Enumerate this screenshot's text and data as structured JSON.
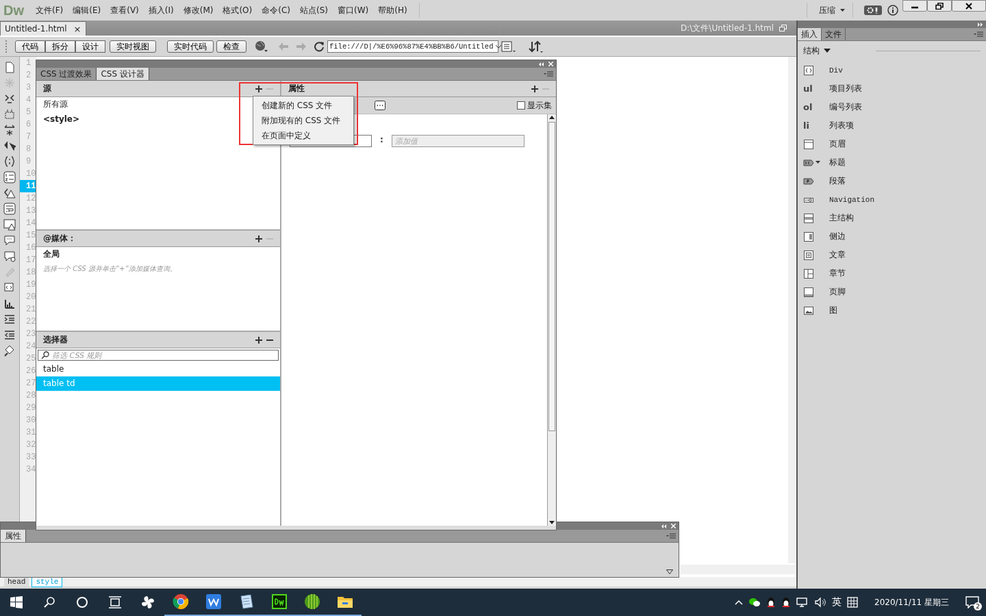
{
  "menu_bar": {
    "logo": "Dw",
    "menus": [
      "文件(F)",
      "编辑(E)",
      "查看(V)",
      "插入(I)",
      "修改(M)",
      "格式(O)",
      "命令(C)",
      "站点(S)",
      "窗口(W)",
      "帮助(H)"
    ],
    "workspace": "压缩"
  },
  "document": {
    "tab": "Untitled-1.html",
    "close": "×",
    "path": "D:\\文件\\Untitled-1.html"
  },
  "toolbar": {
    "view_buttons": [
      "代码",
      "拆分",
      "设计",
      "实时视图"
    ],
    "buttons": [
      "实时代码",
      "检查"
    ],
    "address": "file:///D|/%E6%96%87%E4%BB%B6/Untitled"
  },
  "line_numbers": [
    {
      "number": "1",
      "selected": false
    },
    {
      "number": "2",
      "selected": false
    },
    {
      "number": "3",
      "selected": false
    },
    {
      "number": "4",
      "selected": false
    },
    {
      "number": "5",
      "selected": false
    },
    {
      "number": "6",
      "selected": false
    },
    {
      "number": "7",
      "selected": false
    },
    {
      "number": "8",
      "selected": false
    },
    {
      "number": "9",
      "selected": false
    },
    {
      "number": "10",
      "selected": false
    },
    {
      "number": "11",
      "selected": true
    },
    {
      "number": "12",
      "selected": false
    },
    {
      "number": "13",
      "selected": false
    },
    {
      "number": "14",
      "selected": false
    },
    {
      "number": "15",
      "selected": false
    },
    {
      "number": "16",
      "selected": false
    },
    {
      "number": "17",
      "selected": false
    },
    {
      "number": "18",
      "selected": false
    },
    {
      "number": "19",
      "selected": false
    },
    {
      "number": "20",
      "selected": false
    },
    {
      "number": "21",
      "selected": false
    },
    {
      "number": "22",
      "selected": false
    },
    {
      "number": "23",
      "selected": false
    },
    {
      "number": "24",
      "selected": false
    },
    {
      "number": "25",
      "selected": false
    },
    {
      "number": "26",
      "selected": false
    },
    {
      "number": "27",
      "selected": false
    },
    {
      "number": "28",
      "selected": false
    },
    {
      "number": "29",
      "selected": false
    },
    {
      "number": "30",
      "selected": false
    },
    {
      "number": "31",
      "selected": false
    },
    {
      "number": "32",
      "selected": false
    },
    {
      "number": "33",
      "selected": false
    },
    {
      "number": "34",
      "selected": false
    }
  ],
  "css_designer": {
    "tabs": [
      {
        "label": "CSS 过渡效果",
        "selected": false
      },
      {
        "label": "CSS 设计器",
        "selected": true
      }
    ],
    "sources": {
      "title": "源",
      "items": [
        {
          "label": "所有源",
          "bold": false
        },
        {
          "label": "<style>",
          "bold": true
        }
      ]
    },
    "add_menu": [
      "创建新的 CSS 文件",
      "附加现有的 CSS 文件",
      "在页面中定义"
    ],
    "media": {
      "title": "@媒体：",
      "items": [
        "全局"
      ],
      "hint": "选择一个 CSS 源并单击“+”添加媒体查询。"
    },
    "selectors": {
      "title": "选择器",
      "placeholder": "筛选 CSS 规则",
      "items": [
        {
          "label": "table",
          "selected": false
        },
        {
          "label": "table td",
          "selected": true
        }
      ]
    },
    "properties": {
      "title": "属性",
      "show_set": {
        "label": "显示集",
        "checked": false
      },
      "separator": ":",
      "value_placeholder": "添加值"
    }
  },
  "properties_panel": {
    "tab": "属性"
  },
  "tag_selector": [
    {
      "label": "head",
      "selected": false
    },
    {
      "label": "style",
      "selected": true
    }
  ],
  "insert_panel": {
    "tabs": [
      {
        "label": "插入",
        "selected": true
      },
      {
        "label": "文件",
        "selected": false
      }
    ],
    "category": "结构",
    "items": [
      {
        "label": "Div",
        "kind": "div"
      },
      {
        "label": "项目列表",
        "kind": "tag",
        "tag": "ul"
      },
      {
        "label": "编号列表",
        "kind": "tag",
        "tag": "ol"
      },
      {
        "label": "列表项",
        "kind": "tag",
        "tag": "li"
      },
      {
        "label": "页眉",
        "kind": "header"
      },
      {
        "label": "标题",
        "kind": "heading"
      },
      {
        "label": "段落",
        "kind": "paragraph"
      },
      {
        "label": "Navigation",
        "kind": "nav"
      },
      {
        "label": "主结构",
        "kind": "main"
      },
      {
        "label": "侧边",
        "kind": "aside"
      },
      {
        "label": "文章",
        "kind": "article"
      },
      {
        "label": "章节",
        "kind": "section"
      },
      {
        "label": "页脚",
        "kind": "footer"
      },
      {
        "label": "图",
        "kind": "figure"
      }
    ]
  },
  "taskbar": {
    "language": "英",
    "date": "2020/11/11 星期三",
    "notifications": "2"
  }
}
